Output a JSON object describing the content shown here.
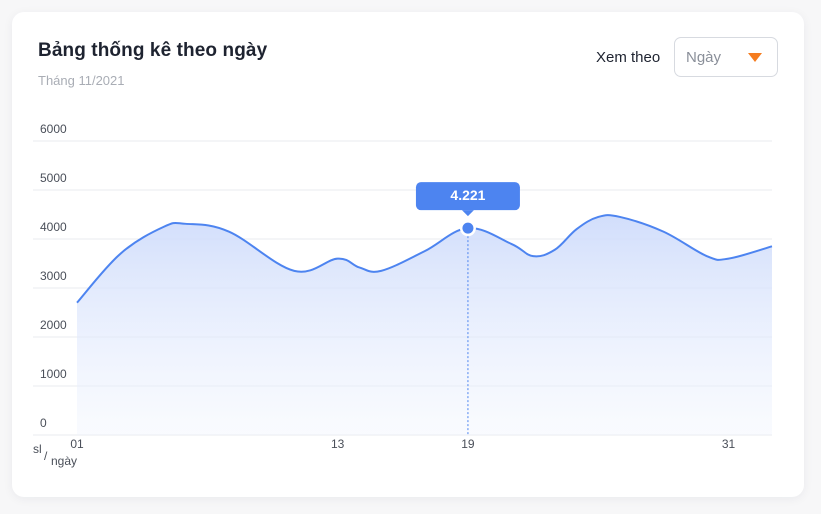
{
  "header": {
    "title": "Bảng thống kê theo ngày",
    "subtitle": "Tháng 11/2021"
  },
  "controls": {
    "view_label": "Xem theo",
    "view_selected": "Ngày",
    "caret_icon": "chevron-down-icon"
  },
  "colors": {
    "line": "#4d84f0",
    "area_top": "#cfdcfb",
    "tooltip_bg": "#4d84f0",
    "caret": "#f57c1f"
  },
  "chart_data": {
    "type": "area",
    "title": "Bảng thống kê theo ngày",
    "subtitle": "Tháng 11/2021",
    "x_unit": "sl",
    "y_unit": "ngày",
    "ylim": [
      0,
      6000
    ],
    "yticks": [
      "6000",
      "5000",
      "4000",
      "3000",
      "2000",
      "1000",
      "0"
    ],
    "xticks": [
      "01",
      "13",
      "19",
      "31"
    ],
    "xlim": [
      1,
      33
    ],
    "grid": true,
    "x": [
      1,
      3,
      5,
      6,
      8,
      11,
      13,
      14,
      15,
      17,
      19,
      21,
      22,
      23,
      24,
      25,
      26,
      28,
      30,
      31,
      33
    ],
    "values": [
      2700,
      3700,
      4250,
      4310,
      4150,
      3350,
      3600,
      3420,
      3350,
      3750,
      4221,
      3900,
      3650,
      3780,
      4200,
      4450,
      4450,
      4150,
      3650,
      3600,
      3850
    ],
    "highlight": {
      "x": "19",
      "value": 4221,
      "label": "4.221"
    }
  }
}
